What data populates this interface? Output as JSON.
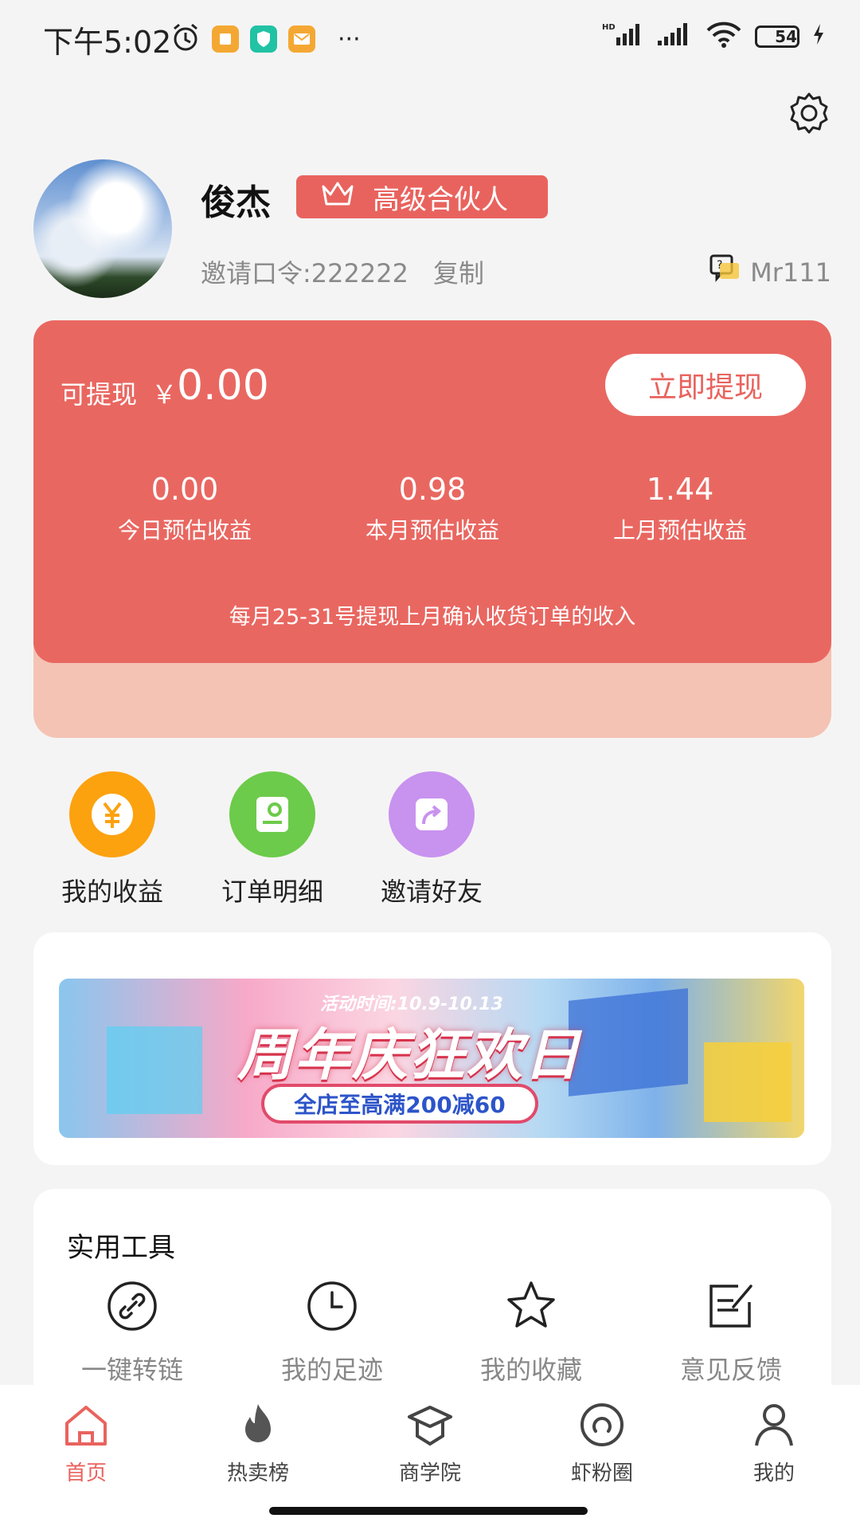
{
  "status_bar": {
    "time": "下午5:02",
    "battery": "54",
    "network": "HD"
  },
  "profile": {
    "name": "俊杰",
    "badge": "高级合伙人",
    "invite_code": "邀请口令:222222",
    "copy_label": "复制",
    "support_user": "Mr111"
  },
  "earnings": {
    "withdrawable_label": "可提现",
    "currency": "￥",
    "withdrawable_amount": "0.00",
    "withdraw_button": "立即提现",
    "stats": [
      {
        "value": "0.00",
        "label": "今日预估收益"
      },
      {
        "value": "0.98",
        "label": "本月预估收益"
      },
      {
        "value": "1.44",
        "label": "上月预估收益"
      }
    ],
    "note": "每月25-31号提现上月确认收货订单的收入"
  },
  "quick_actions": [
    {
      "label": "我的收益",
      "icon": "yuan-icon",
      "color": "#fca20f"
    },
    {
      "label": "订单明细",
      "icon": "order-icon",
      "color": "#6ccb4a"
    },
    {
      "label": "邀请好友",
      "icon": "share-icon",
      "color": "#c892ef"
    }
  ],
  "banner": {
    "date_text": "活动时间:10.9-10.13",
    "title": "周年庆狂欢日",
    "promo": "全店至高满200减60"
  },
  "tools": {
    "title": "实用工具",
    "items": [
      {
        "label": "一键转链",
        "icon": "link-icon"
      },
      {
        "label": "我的足迹",
        "icon": "clock-icon"
      },
      {
        "label": "我的收藏",
        "icon": "star-icon"
      },
      {
        "label": "意见反馈",
        "icon": "feedback-icon"
      }
    ]
  },
  "tabbar": {
    "items": [
      {
        "label": "首页",
        "icon": "home-icon",
        "active": true
      },
      {
        "label": "热卖榜",
        "icon": "fire-icon",
        "active": false
      },
      {
        "label": "商学院",
        "icon": "graduation-cap-icon",
        "active": false
      },
      {
        "label": "虾粉圈",
        "icon": "circle-icon",
        "active": false
      },
      {
        "label": "我的",
        "icon": "person-icon",
        "active": false
      }
    ]
  },
  "colors": {
    "accent": "#e9635e",
    "active_tab": "#e9635e"
  }
}
